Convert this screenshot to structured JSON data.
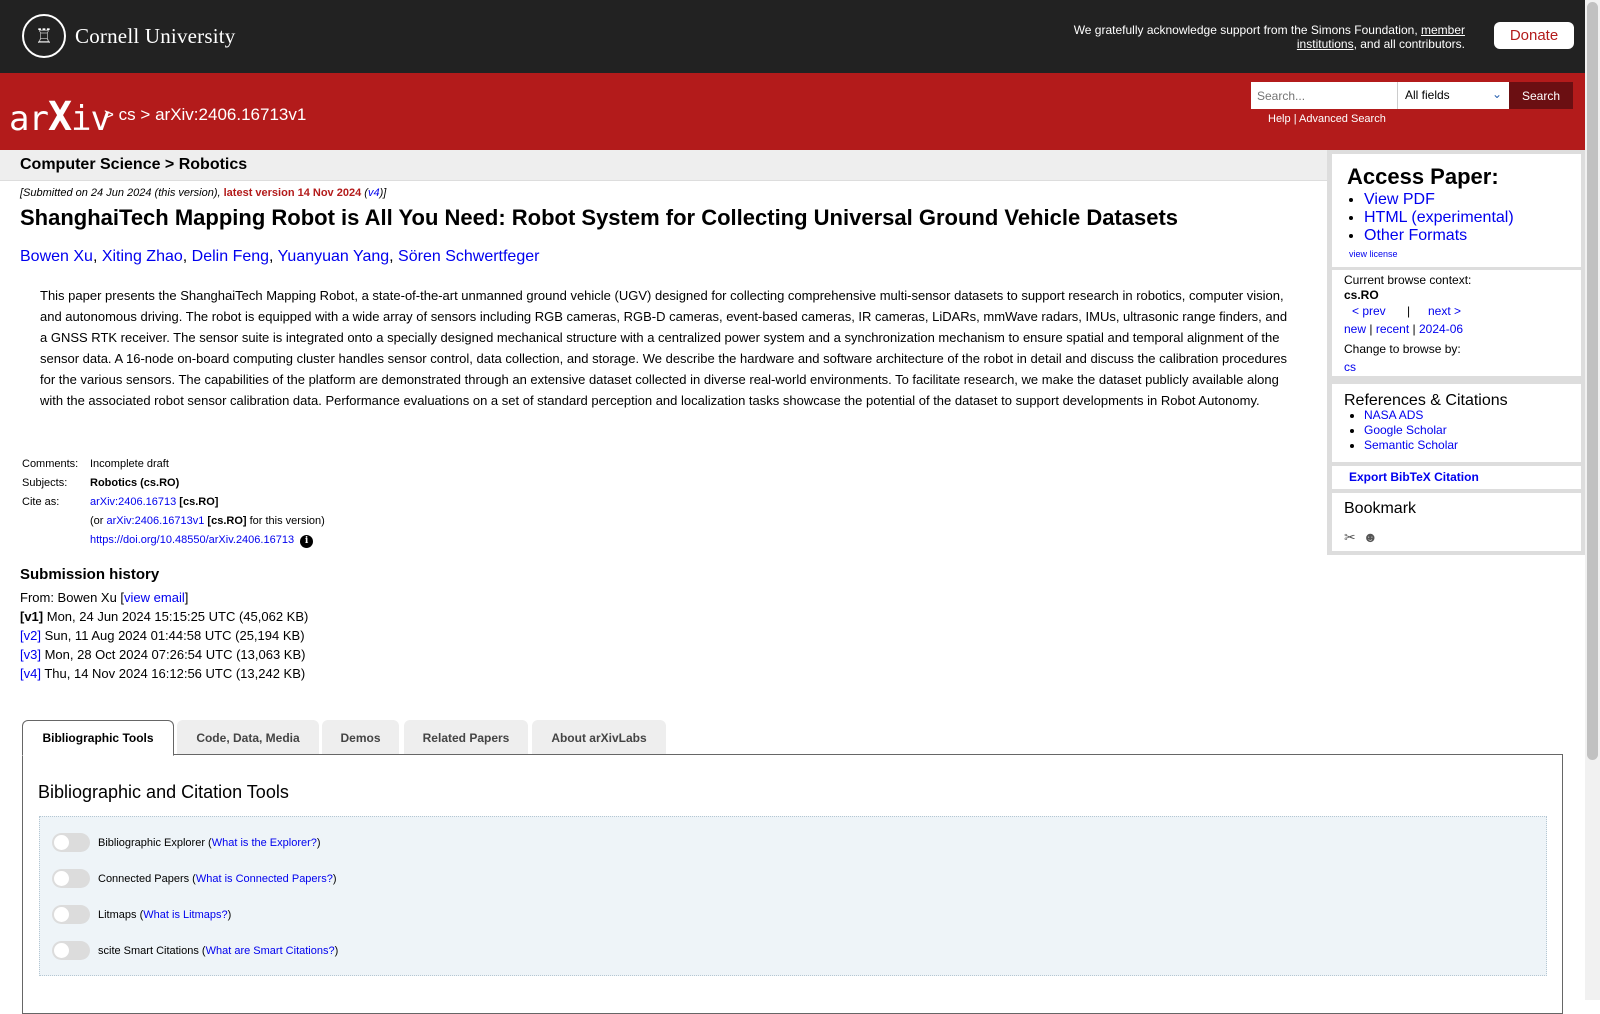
{
  "topbar": {
    "university": "Cornell University",
    "seal_glyph": "♖",
    "support_text": "We gratefully acknowledge support from the Simons Foundation, ",
    "support_link": "member institutions",
    "support_tail": ", and all contributors.",
    "donate": "Donate"
  },
  "header": {
    "logo_pre": "ar",
    "logo_x": "X",
    "logo_post": "iv",
    "crumb_sep": ">",
    "crumb_cs": "cs",
    "crumb_paper": "arXiv:2406.16713v1",
    "search_placeholder": "Search...",
    "search_field": "All fields",
    "search_button": "Search",
    "help": "Help",
    "advanced": "Advanced Search",
    "link_sep": "|"
  },
  "paper": {
    "subheader": "Computer Science > Robotics",
    "dateline_pre": "[Submitted on 24 Jun 2024 (this version), ",
    "dateline_latest": "latest version 14 Nov 2024",
    "dateline_open": " (",
    "dateline_v4": "v4",
    "dateline_close": ")]",
    "title": "ShanghaiTech Mapping Robot is All You Need: Robot System for Collecting Universal Ground Vehicle Datasets",
    "authors": [
      "Bowen Xu",
      "Xiting Zhao",
      "Delin Feng",
      "Yuanyuan Yang",
      "Sören Schwertfeger"
    ],
    "author_sep": ", ",
    "abstract": "This paper presents the ShanghaiTech Mapping Robot, a state-of-the-art unmanned ground vehicle (UGV) designed for collecting comprehensive multi-sensor datasets to support research in robotics, computer vision, and autonomous driving. The robot is equipped with a wide array of sensors including RGB cameras, RGB-D cameras, event-based cameras, IR cameras, LiDARs, mmWave radars, IMUs, ultrasonic range finders, and a GNSS RTK receiver. The sensor suite is integrated onto a specially designed mechanical structure with a centralized power system and a synchronization mechanism to ensure spatial and temporal alignment of the sensor data. A 16-node on-board computing cluster handles sensor control, data collection, and storage. We describe the hardware and software architecture of the robot in detail and discuss the calibration procedures for the various sensors. The capabilities of the platform are demonstrated through an extensive dataset collected in diverse real-world environments. To facilitate research, we make the dataset publicly available along with the associated robot sensor calibration data. Performance evaluations on a set of standard perception and localization tasks showcase the potential of the dataset to support developments in Robot Autonomy.",
    "meta": {
      "comments_label": "Comments:",
      "comments": "Incomplete draft",
      "subjects_label": "Subjects:",
      "subjects": "Robotics (cs.RO)",
      "cite_label": "Cite as:",
      "cite_id": "arXiv:2406.16713",
      "cite_cat": "[cs.RO]",
      "or_pre": "(or ",
      "or_id": "arXiv:2406.16713v1",
      "or_cat": "[cs.RO]",
      "or_post": " for this version)",
      "doi": "https://doi.org/10.48550/arXiv.2406.16713",
      "info_glyph": "i"
    },
    "history": {
      "heading": "Submission history",
      "from_pre": "From: Bowen Xu [",
      "from_link": "view email",
      "from_post": "]",
      "versions": [
        {
          "tag": "[v1]",
          "text": " Mon, 24 Jun 2024 15:15:25 UTC (45,062 KB)"
        },
        {
          "tag": "[v2]",
          "text": " Sun, 11 Aug 2024 01:44:58 UTC (25,194 KB)"
        },
        {
          "tag": "[v3]",
          "text": " Mon, 28 Oct 2024 07:26:54 UTC (13,063 KB)"
        },
        {
          "tag": "[v4]",
          "text": " Thu, 14 Nov 2024 16:12:56 UTC (13,242 KB)"
        }
      ]
    }
  },
  "tabs": [
    {
      "label": "Bibliographic Tools",
      "active": true
    },
    {
      "label": "Code, Data, Media",
      "active": false
    },
    {
      "label": "Demos",
      "active": false
    },
    {
      "label": "Related Papers",
      "active": false
    },
    {
      "label": "About arXivLabs",
      "active": false
    }
  ],
  "tabpanel": {
    "heading": "Bibliographic and Citation Tools",
    "tools": [
      {
        "name": "Bibliographic Explorer",
        "link": "What is the Explorer?"
      },
      {
        "name": "Connected Papers",
        "link": "What is Connected Papers?"
      },
      {
        "name": "Litmaps",
        "link": "What is Litmaps?"
      },
      {
        "name": "scite Smart Citations",
        "link": "What are Smart Citations?"
      }
    ]
  },
  "sidebar": {
    "access_heading": "Access Paper:",
    "access_links": [
      "View PDF",
      "HTML (experimental)",
      "Other Formats"
    ],
    "view_license": "view license",
    "context_label": "Current browse context:",
    "context": "cs.RO",
    "prev": "< prev",
    "pipe": "|",
    "next": "next >",
    "new": "new",
    "recent": "recent",
    "month": "2024-06",
    "change_label": "Change to browse by:",
    "change_cs": "cs",
    "refs_heading": "References & Citations",
    "refs": [
      "NASA ADS",
      "Google Scholar",
      "Semantic Scholar"
    ],
    "bibtex": "Export BibTeX Citation",
    "bookmark_heading": "Bookmark",
    "bookmark_icons": [
      "✂",
      "☻"
    ]
  },
  "colors": {
    "arxiv_red": "#b31b1b",
    "topbar": "#222222",
    "link": "#0000ee"
  }
}
